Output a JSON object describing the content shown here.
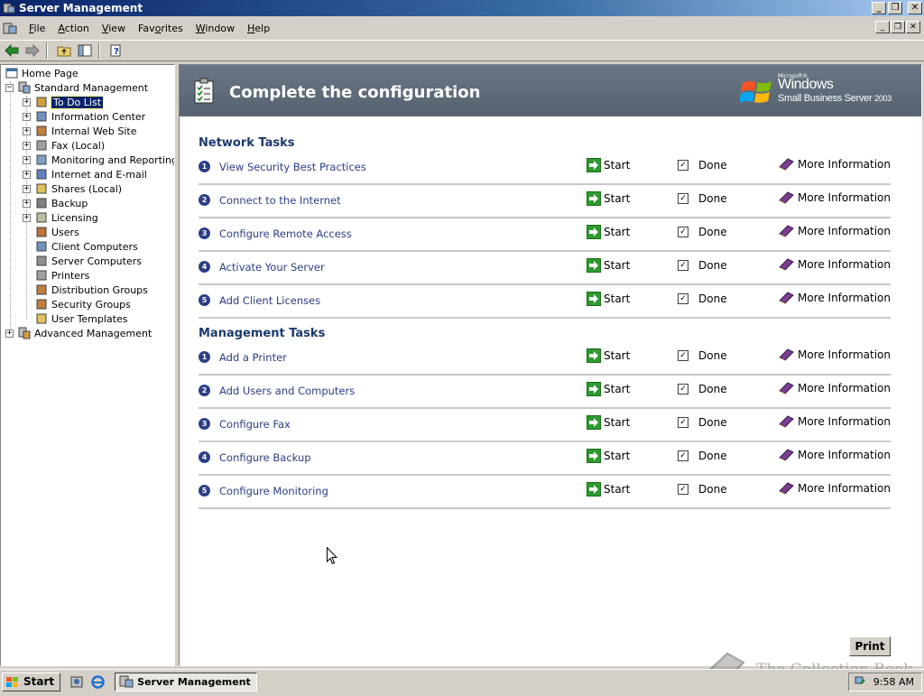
{
  "window": {
    "title": "Server Management"
  },
  "menu": {
    "items": [
      {
        "label": "File",
        "key": "F"
      },
      {
        "label": "Action",
        "key": "A"
      },
      {
        "label": "View",
        "key": "V"
      },
      {
        "label": "Favorites",
        "key": "o"
      },
      {
        "label": "Window",
        "key": "W"
      },
      {
        "label": "Help",
        "key": "H"
      }
    ]
  },
  "tree": {
    "home": "Home Page",
    "standard": "Standard Management",
    "items": [
      "To Do List",
      "Information Center",
      "Internal Web Site",
      "Fax (Local)",
      "Monitoring and Reporting",
      "Internet and E-mail",
      "Shares (Local)",
      "Backup",
      "Licensing",
      "Users",
      "Client Computers",
      "Server Computers",
      "Printers",
      "Distribution Groups",
      "Security Groups",
      "User Templates"
    ],
    "advanced": "Advanced Management",
    "selected": "To Do List"
  },
  "banner": {
    "title": "Complete the configuration",
    "brand_small": "Microsoft®",
    "brand_windows": "Windows",
    "brand_product": "Small Business Server",
    "brand_year": "2003"
  },
  "sections": [
    {
      "title": "Network Tasks",
      "tasks": [
        {
          "num": "1",
          "name": "View Security Best Practices"
        },
        {
          "num": "2",
          "name": "Connect to the Internet"
        },
        {
          "num": "3",
          "name": "Configure Remote Access"
        },
        {
          "num": "4",
          "name": "Activate Your Server"
        },
        {
          "num": "5",
          "name": "Add Client Licenses"
        }
      ]
    },
    {
      "title": "Management Tasks",
      "tasks": [
        {
          "num": "1",
          "name": "Add a Printer"
        },
        {
          "num": "2",
          "name": "Add Users and Computers"
        },
        {
          "num": "3",
          "name": "Configure Fax"
        },
        {
          "num": "4",
          "name": "Configure Backup"
        },
        {
          "num": "5",
          "name": "Configure Monitoring"
        }
      ]
    }
  ],
  "task_labels": {
    "start": "Start",
    "done": "Done",
    "more": "More Information",
    "done_checked": true
  },
  "print_label": "Print",
  "watermark": "The Collection Book",
  "taskbar": {
    "start": "Start",
    "task": "Server Management",
    "clock": "9:58 AM"
  },
  "colors": {
    "title_active": "#0a246a",
    "banner": "#5d6a79",
    "link": "#2b3f86",
    "selection": "#0a246a"
  }
}
